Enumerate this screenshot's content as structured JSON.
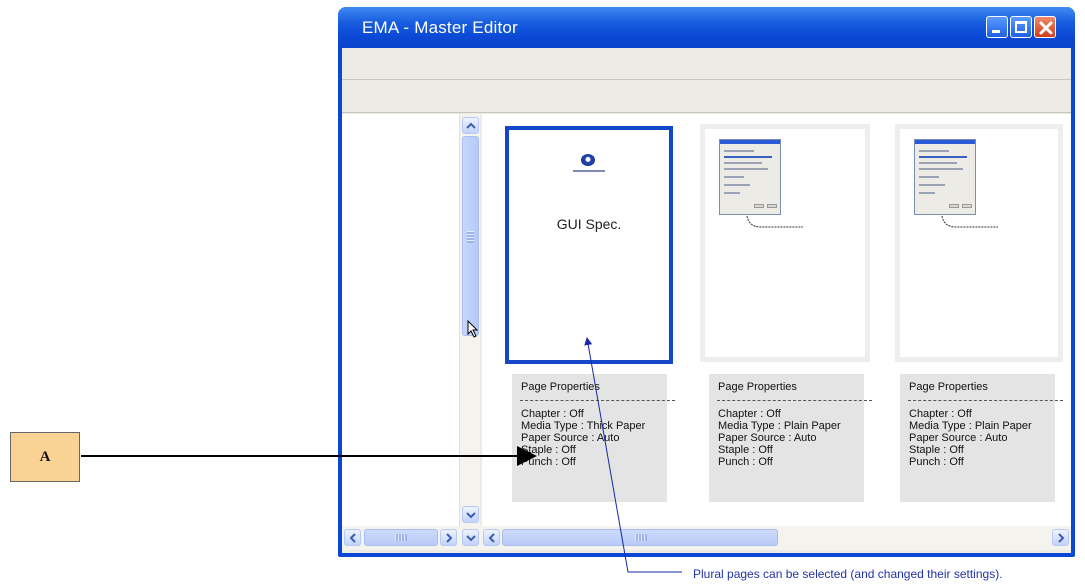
{
  "window": {
    "title": "EMA - Master Editor",
    "title_bar_color": "#0a47d6",
    "buttons": {
      "minimize_icon": "minimize-icon",
      "maximize_icon": "maximize-icon",
      "close_icon": "close-icon"
    }
  },
  "pages": [
    {
      "label": "GUI Spec.",
      "selected": true,
      "preview": "cover-page-with-logo",
      "properties": {
        "title": "Page Properties",
        "lines": [
          "Chapter : Off",
          "Media Type : Thick Paper",
          "Paper Source : Auto",
          "Staple : Off",
          "Punch : Off"
        ]
      }
    },
    {
      "label": "",
      "selected": false,
      "preview": "dialog-screenshot",
      "properties": {
        "title": "Page Properties",
        "lines": [
          "Chapter : Off",
          "Media Type : Plain Paper",
          "Paper Source : Auto",
          "Staple : Off",
          "Punch : Off"
        ]
      }
    },
    {
      "label": "",
      "selected": false,
      "preview": "dialog-screenshot",
      "properties": {
        "title": "Page Properties",
        "lines": [
          "Chapter : Off",
          "Media Type : Plain Paper",
          "Paper Source : Auto",
          "Staple : Off",
          "Punch : Off"
        ]
      }
    }
  ],
  "annotations": {
    "callout_label": "A",
    "note": "Plural pages can be selected (and changed their settings)."
  },
  "colors": {
    "selection_border": "#1446c8",
    "callout_fill": "#fad394",
    "note_text": "#2233aa"
  }
}
